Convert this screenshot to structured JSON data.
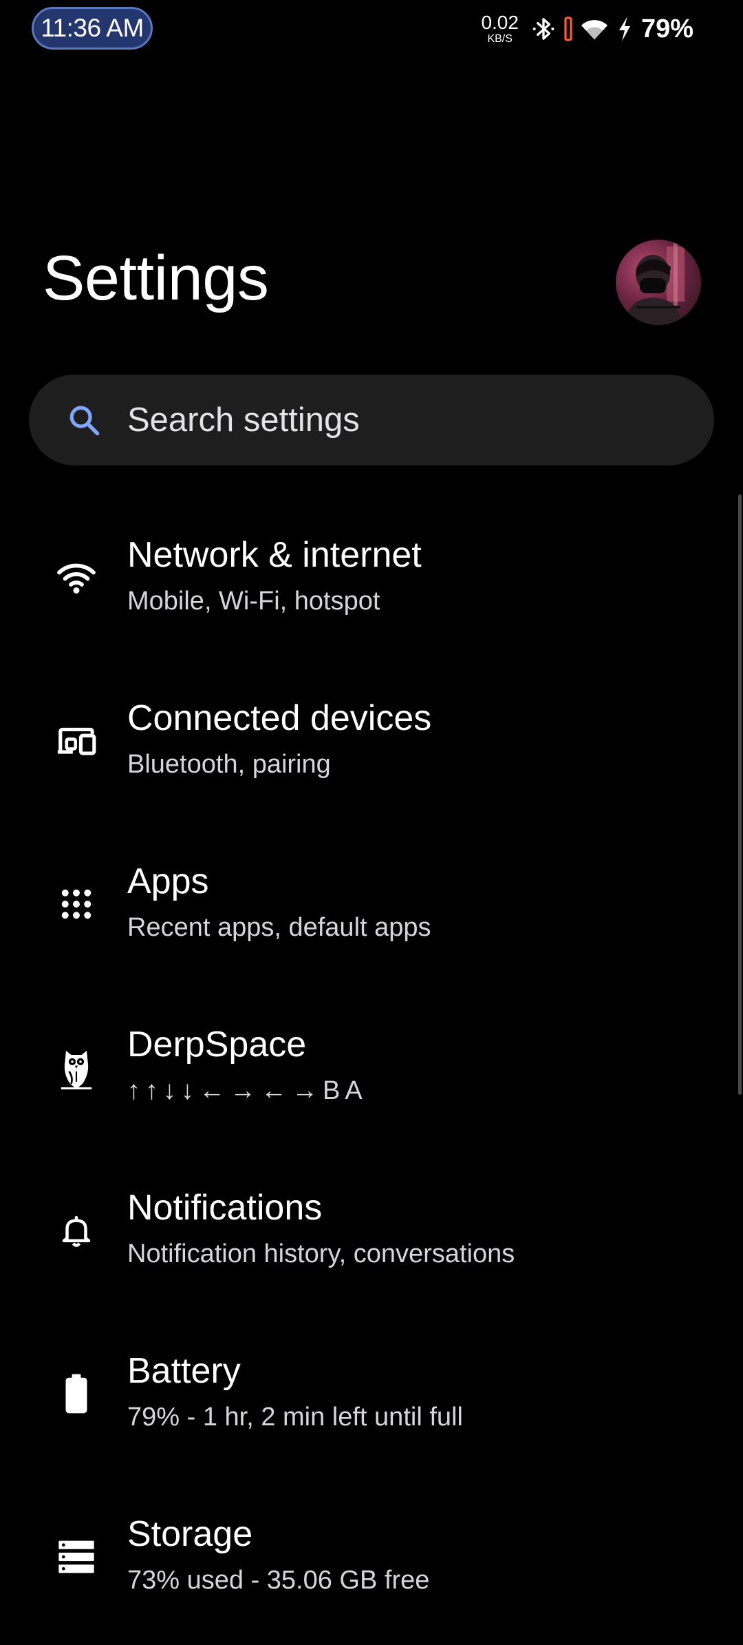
{
  "status_bar": {
    "time": "11:36 AM",
    "net_speed_value": "0.02",
    "net_speed_unit": "KB/S",
    "battery_percent": "79%",
    "icons": [
      "bluetooth-icon",
      "wifi-icon",
      "charging-icon"
    ]
  },
  "header": {
    "title": "Settings"
  },
  "search": {
    "placeholder": "Search settings"
  },
  "settings": {
    "items": [
      {
        "icon": "wifi-icon",
        "title": "Network & internet",
        "subtitle": "Mobile, Wi-Fi, hotspot"
      },
      {
        "icon": "devices-icon",
        "title": "Connected devices",
        "subtitle": "Bluetooth, pairing"
      },
      {
        "icon": "apps-grid-icon",
        "title": "Apps",
        "subtitle": "Recent apps, default apps"
      },
      {
        "icon": "owl-icon",
        "title": "DerpSpace",
        "subtitle": "↑↑↓↓←→←→BA"
      },
      {
        "icon": "bell-icon",
        "title": "Notifications",
        "subtitle": "Notification history, conversations"
      },
      {
        "icon": "battery-icon",
        "title": "Battery",
        "subtitle": "79% - 1 hr, 2 min left until full"
      },
      {
        "icon": "storage-icon",
        "title": "Storage",
        "subtitle": "73% used - 35.06 GB free"
      }
    ]
  },
  "colors": {
    "background": "#000000",
    "search_background": "#1e1e1f",
    "clock_pill": "#23376e",
    "search_icon": "#7fa5ff",
    "charging_bar": "#ff5a3c"
  }
}
